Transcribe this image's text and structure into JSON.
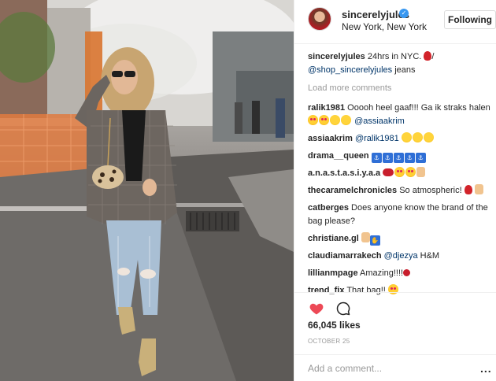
{
  "header": {
    "username": "sincerelyjules",
    "location": "New York, New York",
    "follow_label": "Following"
  },
  "caption": {
    "username": "sincerelyjules",
    "text": "24hrs in NYC.",
    "slash": "/",
    "mention": "@shop_sincerelyjules",
    "suffix": "jeans"
  },
  "load_more_label": "Load more comments",
  "comments": [
    {
      "user": "ralik1981",
      "text": "Ooooh heel gaaf!!! Ga ik straks halen",
      "mention": "@assiaakrim"
    },
    {
      "user": "assiaakrim",
      "mention": "@ralik1981"
    },
    {
      "user": "drama__queen"
    },
    {
      "user": "a.n.a.s.t.a.s.i.y.a.a"
    },
    {
      "user": "thecaramelchronicles",
      "text": "So atmospheric!"
    },
    {
      "user": "catberges",
      "text": "Does anyone know the brand of the bag please?"
    },
    {
      "user": "christiane.gl"
    },
    {
      "user": "claudiamarrakech",
      "mention": "@djezya",
      "text": "H&M"
    },
    {
      "user": "lillianmpage",
      "text": "Amazing!!!!"
    },
    {
      "user": "trend_fix",
      "text": "That bag!!"
    }
  ],
  "likes_text": "66,045 likes",
  "date_text": "October 25",
  "add_comment_placeholder": "Add a comment...",
  "more_label": "...",
  "colors": {
    "like": "#ed4956",
    "link": "#003569",
    "verified": "#3897f0"
  },
  "icons": [
    "heart-icon",
    "comment-bubble-icon",
    "verified-badge-icon",
    "more-options-icon"
  ]
}
